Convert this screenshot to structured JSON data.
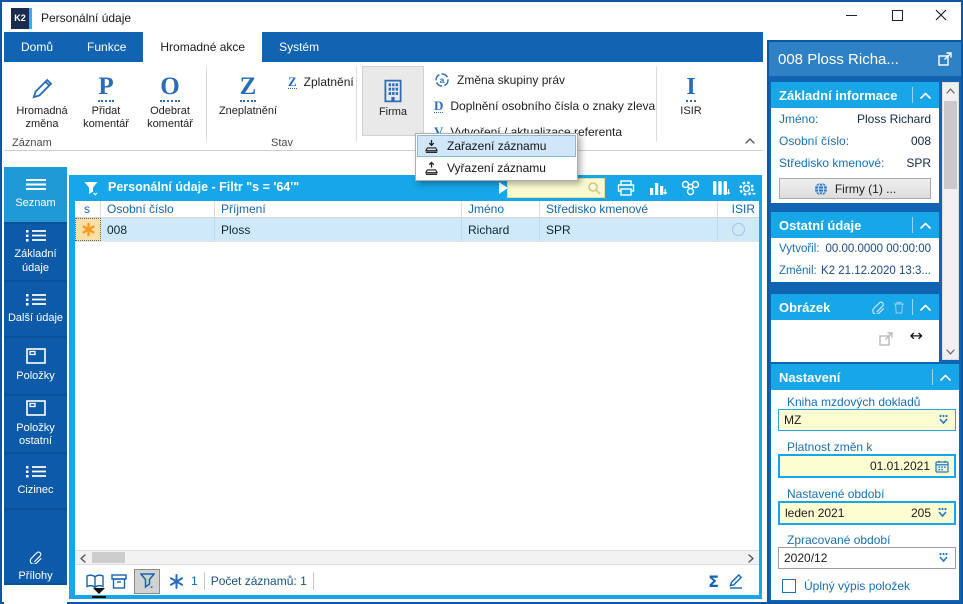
{
  "window": {
    "title": "Personální údaje",
    "logo_text": "K2"
  },
  "colors": {
    "accent_cyan": "#17a6e7",
    "dark_blue": "#0d5aa9",
    "tab_blue": "#1164b2",
    "panel_header_blue": "#2f81c5",
    "selection_blue": "#cfe9f8",
    "field_yellow": "#fdfdd2",
    "link_blue": "#1a6fb5",
    "icon_blue": "#2b6cb8",
    "star_orange": "#f49b20"
  },
  "ribbon": {
    "tabs": [
      {
        "label": "Domů"
      },
      {
        "label": "Funkce"
      },
      {
        "label": "Hromadné akce"
      },
      {
        "label": "Systém"
      }
    ],
    "buttons": {
      "hromadna_zmena": "Hromadná změna",
      "pridat_komentar": "Přidat komentář",
      "odebrat_komentar": "Odebrat komentář",
      "zneplatneni": "Zneplatnění",
      "zplatneni": "Zplatnění",
      "firma": "Firma",
      "isir": "ISIR"
    },
    "group_labels": {
      "zaznam": "Záznam",
      "stav": "Stav"
    },
    "menu_items": [
      {
        "label": "Změna skupiny práv"
      },
      {
        "label": "Doplnění osobního čísla o znaky zleva"
      },
      {
        "label": "Vytvoření / aktualizace referenta"
      }
    ]
  },
  "dropdown_menu": {
    "items": [
      {
        "label": "Zařazení záznamu"
      },
      {
        "label": "Vyřazení záznamu"
      }
    ]
  },
  "sidebar": {
    "items": [
      {
        "label": "Seznam"
      },
      {
        "label": "Základní údaje"
      },
      {
        "label": "Další údaje"
      },
      {
        "label": "Položky"
      },
      {
        "label": "Položky ostatní"
      },
      {
        "label": "Cizinec"
      },
      {
        "label": "Přílohy"
      }
    ]
  },
  "grid": {
    "filter_title": "Personální údaje - Filtr \"s = '64'\"",
    "columns": [
      {
        "label": "s"
      },
      {
        "label": "Osobní číslo"
      },
      {
        "label": "Příjmení"
      },
      {
        "label": "Jméno"
      },
      {
        "label": "Středisko kmenové"
      },
      {
        "label": "ISIR"
      }
    ],
    "row": {
      "osobni_cislo": "008",
      "prijmeni": "Ploss",
      "jmeno": "Richard",
      "stredisko_kmenove": "SPR"
    }
  },
  "statusbar": {
    "star_count": "1",
    "records_label": "Počet záznamů: 1",
    "sum_glyph": "Σ"
  },
  "panel": {
    "title": "008 Ploss Richa...",
    "zakladni": {
      "title": "Základní informace",
      "rows": [
        {
          "label": "Jméno:",
          "value": "Ploss Richard"
        },
        {
          "label": "Osobní číslo:",
          "value": "008"
        },
        {
          "label": "Středisko kmenové:",
          "value": "SPR"
        }
      ],
      "firmy_button": "Firmy (1) ..."
    },
    "ostatni": {
      "title": "Ostatní údaje",
      "rows": [
        {
          "label": "Vytvořil:",
          "value": "00.00.0000 00:00:00"
        },
        {
          "label": "Změnil:",
          "value": "K2 21.12.2020 13:3..."
        }
      ]
    },
    "obrazek": {
      "title": "Obrázek",
      "resize_glyph": "↔"
    },
    "nastaveni": {
      "title": "Nastavení",
      "kniha": {
        "label": "Kniha mzdových dokladů",
        "value": "MZ"
      },
      "platnost": {
        "label": "Platnost změn k",
        "value": "01.01.2021"
      },
      "obdobi": {
        "label": "Nastavené období",
        "value": "leden 2021",
        "extra": "205"
      },
      "zpracovane": {
        "label": "Zpracované období",
        "value": "2020/12"
      },
      "checkbox_label": "Úplný výpis položek"
    }
  }
}
